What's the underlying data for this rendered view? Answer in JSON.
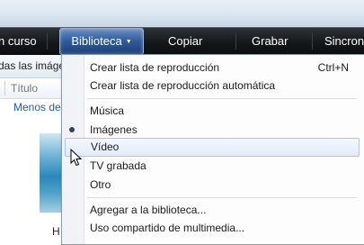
{
  "nav": {
    "items": [
      {
        "label": "n curso"
      },
      {
        "label": "Biblioteca"
      },
      {
        "label": "Copiar"
      },
      {
        "label": "Grabar"
      },
      {
        "label": "Sincroni"
      }
    ]
  },
  "left_pane": {
    "toolbar_text": "das las imágen",
    "column_header": "Título",
    "link": "Menos de",
    "thumb_caption": "H"
  },
  "menu": {
    "items": [
      {
        "label": "Crear lista de reproducción",
        "shortcut": "Ctrl+N"
      },
      {
        "label": "Crear lista de reproducción automática"
      },
      {
        "label": "Música"
      },
      {
        "label": "Imágenes",
        "selected": true
      },
      {
        "label": "Vídeo",
        "highlighted": true
      },
      {
        "label": "TV grabada"
      },
      {
        "label": "Otro"
      },
      {
        "label": "Agregar a la biblioteca..."
      },
      {
        "label": "Uso compartido de multimedia..."
      }
    ]
  },
  "colors": {
    "nav_bg": "#15181b",
    "nav_active": "#2f5a98",
    "menu_highlight_border": "#a9c6ea",
    "link": "#1d5fa8"
  },
  "icons": [
    "chevron-down-icon",
    "radio-dot-icon",
    "mouse-pointer-icon"
  ]
}
